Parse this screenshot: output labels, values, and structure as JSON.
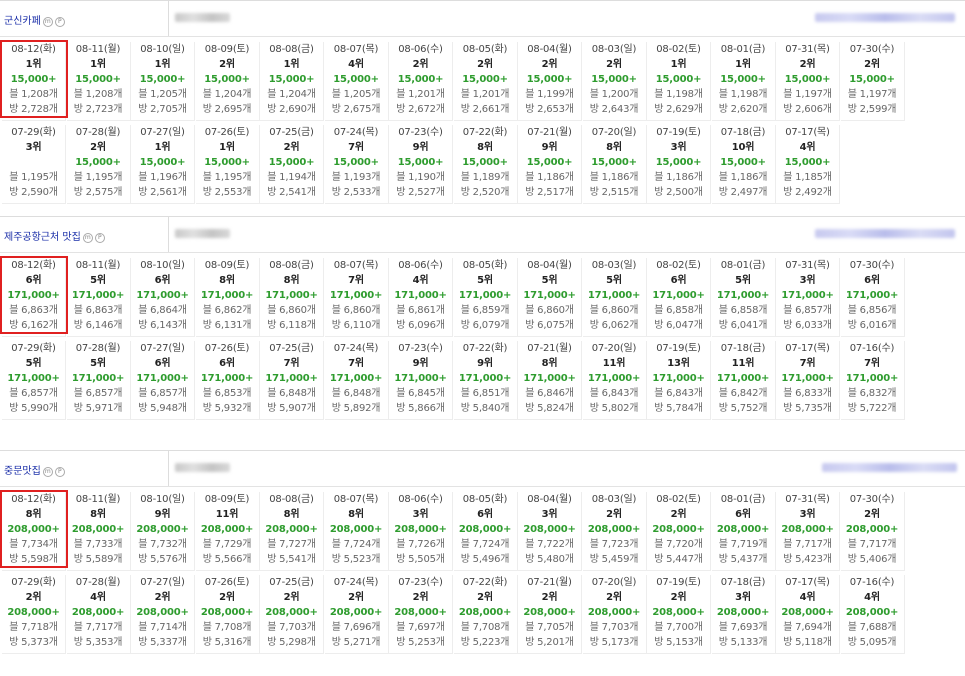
{
  "sections": [
    {
      "keyword": "군신카페",
      "badges": [
        "m",
        "P"
      ],
      "highlight": true,
      "rows": [
        [
          {
            "date": "08-12(화)",
            "rank": "1위",
            "val": "15,000+",
            "a": "블 1,208개",
            "b": "방 2,728개"
          },
          {
            "date": "08-11(월)",
            "rank": "1위",
            "val": "15,000+",
            "a": "블 1,208개",
            "b": "방 2,723개"
          },
          {
            "date": "08-10(일)",
            "rank": "1위",
            "val": "15,000+",
            "a": "블 1,205개",
            "b": "방 2,705개"
          },
          {
            "date": "08-09(토)",
            "rank": "2위",
            "val": "15,000+",
            "a": "블 1,204개",
            "b": "방 2,695개"
          },
          {
            "date": "08-08(금)",
            "rank": "1위",
            "val": "15,000+",
            "a": "블 1,204개",
            "b": "방 2,690개"
          },
          {
            "date": "08-07(목)",
            "rank": "4위",
            "val": "15,000+",
            "a": "블 1,205개",
            "b": "방 2,675개"
          },
          {
            "date": "08-06(수)",
            "rank": "2위",
            "val": "15,000+",
            "a": "블 1,201개",
            "b": "방 2,672개"
          },
          {
            "date": "08-05(화)",
            "rank": "2위",
            "val": "15,000+",
            "a": "블 1,201개",
            "b": "방 2,661개"
          },
          {
            "date": "08-04(월)",
            "rank": "2위",
            "val": "15,000+",
            "a": "블 1,199개",
            "b": "방 2,653개"
          },
          {
            "date": "08-03(일)",
            "rank": "2위",
            "val": "15,000+",
            "a": "블 1,200개",
            "b": "방 2,643개"
          },
          {
            "date": "08-02(토)",
            "rank": "1위",
            "val": "15,000+",
            "a": "블 1,198개",
            "b": "방 2,629개"
          },
          {
            "date": "08-01(금)",
            "rank": "1위",
            "val": "15,000+",
            "a": "블 1,198개",
            "b": "방 2,620개"
          },
          {
            "date": "07-31(목)",
            "rank": "2위",
            "val": "15,000+",
            "a": "블 1,197개",
            "b": "방 2,606개"
          },
          {
            "date": "07-30(수)",
            "rank": "2위",
            "val": "15,000+",
            "a": "블 1,197개",
            "b": "방 2,599개"
          }
        ],
        [
          {
            "date": "07-29(화)",
            "rank": "3위",
            "val": "",
            "a": "블 1,195개",
            "b": "방 2,590개"
          },
          {
            "date": "07-28(월)",
            "rank": "2위",
            "val": "15,000+",
            "a": "블 1,195개",
            "b": "방 2,575개"
          },
          {
            "date": "07-27(일)",
            "rank": "1위",
            "val": "15,000+",
            "a": "블 1,196개",
            "b": "방 2,561개"
          },
          {
            "date": "07-26(토)",
            "rank": "1위",
            "val": "15,000+",
            "a": "블 1,195개",
            "b": "방 2,553개"
          },
          {
            "date": "07-25(금)",
            "rank": "2위",
            "val": "15,000+",
            "a": "블 1,194개",
            "b": "방 2,541개"
          },
          {
            "date": "07-24(목)",
            "rank": "7위",
            "val": "15,000+",
            "a": "블 1,193개",
            "b": "방 2,533개"
          },
          {
            "date": "07-23(수)",
            "rank": "9위",
            "val": "15,000+",
            "a": "블 1,190개",
            "b": "방 2,527개"
          },
          {
            "date": "07-22(화)",
            "rank": "8위",
            "val": "15,000+",
            "a": "블 1,189개",
            "b": "방 2,520개"
          },
          {
            "date": "07-21(월)",
            "rank": "9위",
            "val": "15,000+",
            "a": "블 1,186개",
            "b": "방 2,517개"
          },
          {
            "date": "07-20(일)",
            "rank": "8위",
            "val": "15,000+",
            "a": "블 1,186개",
            "b": "방 2,515개"
          },
          {
            "date": "07-19(토)",
            "rank": "3위",
            "val": "15,000+",
            "a": "블 1,186개",
            "b": "방 2,500개"
          },
          {
            "date": "07-18(금)",
            "rank": "10위",
            "val": "15,000+",
            "a": "블 1,186개",
            "b": "방 2,497개"
          },
          {
            "date": "07-17(목)",
            "rank": "4위",
            "val": "15,000+",
            "a": "블 1,185개",
            "b": "방 2,492개"
          }
        ]
      ]
    },
    {
      "keyword": "제주공항근처 맛집",
      "badges": [
        "m",
        "P"
      ],
      "highlight": true,
      "rows": [
        [
          {
            "date": "08-12(화)",
            "rank": "6위",
            "val": "171,000+",
            "a": "블 6,863개",
            "b": "방 6,162개"
          },
          {
            "date": "08-11(월)",
            "rank": "5위",
            "val": "171,000+",
            "a": "블 6,863개",
            "b": "방 6,146개"
          },
          {
            "date": "08-10(일)",
            "rank": "6위",
            "val": "171,000+",
            "a": "블 6,864개",
            "b": "방 6,143개"
          },
          {
            "date": "08-09(토)",
            "rank": "8위",
            "val": "171,000+",
            "a": "블 6,862개",
            "b": "방 6,131개"
          },
          {
            "date": "08-08(금)",
            "rank": "8위",
            "val": "171,000+",
            "a": "블 6,860개",
            "b": "방 6,118개"
          },
          {
            "date": "08-07(목)",
            "rank": "7위",
            "val": "171,000+",
            "a": "블 6,860개",
            "b": "방 6,110개"
          },
          {
            "date": "08-06(수)",
            "rank": "4위",
            "val": "171,000+",
            "a": "블 6,861개",
            "b": "방 6,096개"
          },
          {
            "date": "08-05(화)",
            "rank": "5위",
            "val": "171,000+",
            "a": "블 6,859개",
            "b": "방 6,079개"
          },
          {
            "date": "08-04(월)",
            "rank": "5위",
            "val": "171,000+",
            "a": "블 6,860개",
            "b": "방 6,075개"
          },
          {
            "date": "08-03(일)",
            "rank": "5위",
            "val": "171,000+",
            "a": "블 6,860개",
            "b": "방 6,062개"
          },
          {
            "date": "08-02(토)",
            "rank": "6위",
            "val": "171,000+",
            "a": "블 6,858개",
            "b": "방 6,047개"
          },
          {
            "date": "08-01(금)",
            "rank": "5위",
            "val": "171,000+",
            "a": "블 6,858개",
            "b": "방 6,041개"
          },
          {
            "date": "07-31(목)",
            "rank": "3위",
            "val": "171,000+",
            "a": "블 6,857개",
            "b": "방 6,033개"
          },
          {
            "date": "07-30(수)",
            "rank": "6위",
            "val": "171,000+",
            "a": "블 6,856개",
            "b": "방 6,016개"
          }
        ],
        [
          {
            "date": "07-29(화)",
            "rank": "5위",
            "val": "171,000+",
            "a": "블 6,857개",
            "b": "방 5,990개"
          },
          {
            "date": "07-28(월)",
            "rank": "5위",
            "val": "171,000+",
            "a": "블 6,857개",
            "b": "방 5,971개"
          },
          {
            "date": "07-27(일)",
            "rank": "6위",
            "val": "171,000+",
            "a": "블 6,857개",
            "b": "방 5,948개"
          },
          {
            "date": "07-26(토)",
            "rank": "6위",
            "val": "171,000+",
            "a": "블 6,853개",
            "b": "방 5,932개"
          },
          {
            "date": "07-25(금)",
            "rank": "7위",
            "val": "171,000+",
            "a": "블 6,848개",
            "b": "방 5,907개"
          },
          {
            "date": "07-24(목)",
            "rank": "7위",
            "val": "171,000+",
            "a": "블 6,848개",
            "b": "방 5,892개"
          },
          {
            "date": "07-23(수)",
            "rank": "9위",
            "val": "171,000+",
            "a": "블 6,845개",
            "b": "방 5,866개"
          },
          {
            "date": "07-22(화)",
            "rank": "9위",
            "val": "171,000+",
            "a": "블 6,851개",
            "b": "방 5,840개"
          },
          {
            "date": "07-21(월)",
            "rank": "8위",
            "val": "171,000+",
            "a": "블 6,846개",
            "b": "방 5,824개"
          },
          {
            "date": "07-20(일)",
            "rank": "11위",
            "val": "171,000+",
            "a": "블 6,843개",
            "b": "방 5,802개"
          },
          {
            "date": "07-19(토)",
            "rank": "13위",
            "val": "171,000+",
            "a": "블 6,843개",
            "b": "방 5,784개"
          },
          {
            "date": "07-18(금)",
            "rank": "11위",
            "val": "171,000+",
            "a": "블 6,842개",
            "b": "방 5,752개"
          },
          {
            "date": "07-17(목)",
            "rank": "7위",
            "val": "171,000+",
            "a": "블 6,833개",
            "b": "방 5,735개"
          },
          {
            "date": "07-16(수)",
            "rank": "7위",
            "val": "171,000+",
            "a": "블 6,832개",
            "b": "방 5,722개"
          }
        ]
      ]
    },
    {
      "keyword": "중문맛집",
      "badges": [
        "m",
        "P"
      ],
      "highlight": true,
      "rows": [
        [
          {
            "date": "08-12(화)",
            "rank": "8위",
            "val": "208,000+",
            "a": "블 7,734개",
            "b": "방 5,598개"
          },
          {
            "date": "08-11(월)",
            "rank": "8위",
            "val": "208,000+",
            "a": "블 7,733개",
            "b": "방 5,589개"
          },
          {
            "date": "08-10(일)",
            "rank": "9위",
            "val": "208,000+",
            "a": "블 7,732개",
            "b": "방 5,576개"
          },
          {
            "date": "08-09(토)",
            "rank": "11위",
            "val": "208,000+",
            "a": "블 7,729개",
            "b": "방 5,566개"
          },
          {
            "date": "08-08(금)",
            "rank": "8위",
            "val": "208,000+",
            "a": "블 7,727개",
            "b": "방 5,541개"
          },
          {
            "date": "08-07(목)",
            "rank": "8위",
            "val": "208,000+",
            "a": "블 7,724개",
            "b": "방 5,523개"
          },
          {
            "date": "08-06(수)",
            "rank": "3위",
            "val": "208,000+",
            "a": "블 7,726개",
            "b": "방 5,505개"
          },
          {
            "date": "08-05(화)",
            "rank": "6위",
            "val": "208,000+",
            "a": "블 7,724개",
            "b": "방 5,496개"
          },
          {
            "date": "08-04(월)",
            "rank": "3위",
            "val": "208,000+",
            "a": "블 7,722개",
            "b": "방 5,480개"
          },
          {
            "date": "08-03(일)",
            "rank": "2위",
            "val": "208,000+",
            "a": "블 7,723개",
            "b": "방 5,459개"
          },
          {
            "date": "08-02(토)",
            "rank": "2위",
            "val": "208,000+",
            "a": "블 7,720개",
            "b": "방 5,447개"
          },
          {
            "date": "08-01(금)",
            "rank": "6위",
            "val": "208,000+",
            "a": "블 7,719개",
            "b": "방 5,437개"
          },
          {
            "date": "07-31(목)",
            "rank": "3위",
            "val": "208,000+",
            "a": "블 7,717개",
            "b": "방 5,423개"
          },
          {
            "date": "07-30(수)",
            "rank": "2위",
            "val": "208,000+",
            "a": "블 7,717개",
            "b": "방 5,406개"
          }
        ],
        [
          {
            "date": "07-29(화)",
            "rank": "2위",
            "val": "208,000+",
            "a": "블 7,718개",
            "b": "방 5,373개"
          },
          {
            "date": "07-28(월)",
            "rank": "4위",
            "val": "208,000+",
            "a": "블 7,717개",
            "b": "방 5,353개"
          },
          {
            "date": "07-27(일)",
            "rank": "2위",
            "val": "208,000+",
            "a": "블 7,714개",
            "b": "방 5,337개"
          },
          {
            "date": "07-26(토)",
            "rank": "2위",
            "val": "208,000+",
            "a": "블 7,708개",
            "b": "방 5,316개"
          },
          {
            "date": "07-25(금)",
            "rank": "2위",
            "val": "208,000+",
            "a": "블 7,703개",
            "b": "방 5,298개"
          },
          {
            "date": "07-24(목)",
            "rank": "2위",
            "val": "208,000+",
            "a": "블 7,696개",
            "b": "방 5,271개"
          },
          {
            "date": "07-23(수)",
            "rank": "2위",
            "val": "208,000+",
            "a": "블 7,697개",
            "b": "방 5,253개"
          },
          {
            "date": "07-22(화)",
            "rank": "2위",
            "val": "208,000+",
            "a": "블 7,708개",
            "b": "방 5,223개"
          },
          {
            "date": "07-21(월)",
            "rank": "2위",
            "val": "208,000+",
            "a": "블 7,705개",
            "b": "방 5,201개"
          },
          {
            "date": "07-20(일)",
            "rank": "2위",
            "val": "208,000+",
            "a": "블 7,703개",
            "b": "방 5,173개"
          },
          {
            "date": "07-19(토)",
            "rank": "2위",
            "val": "208,000+",
            "a": "블 7,700개",
            "b": "방 5,153개"
          },
          {
            "date": "07-18(금)",
            "rank": "3위",
            "val": "208,000+",
            "a": "블 7,693개",
            "b": "방 5,133개"
          },
          {
            "date": "07-17(목)",
            "rank": "4위",
            "val": "208,000+",
            "a": "블 7,694개",
            "b": "방 5,118개"
          },
          {
            "date": "07-16(수)",
            "rank": "4위",
            "val": "208,000+",
            "a": "블 7,688개",
            "b": "방 5,095개"
          }
        ]
      ]
    }
  ],
  "colors": {
    "keyword": "#1a2ea8",
    "value_green": "#2e9c2e",
    "highlight_red": "#e02020",
    "redacted_gray": "#cccccc",
    "redacted_purple": "#c7c9ef"
  }
}
